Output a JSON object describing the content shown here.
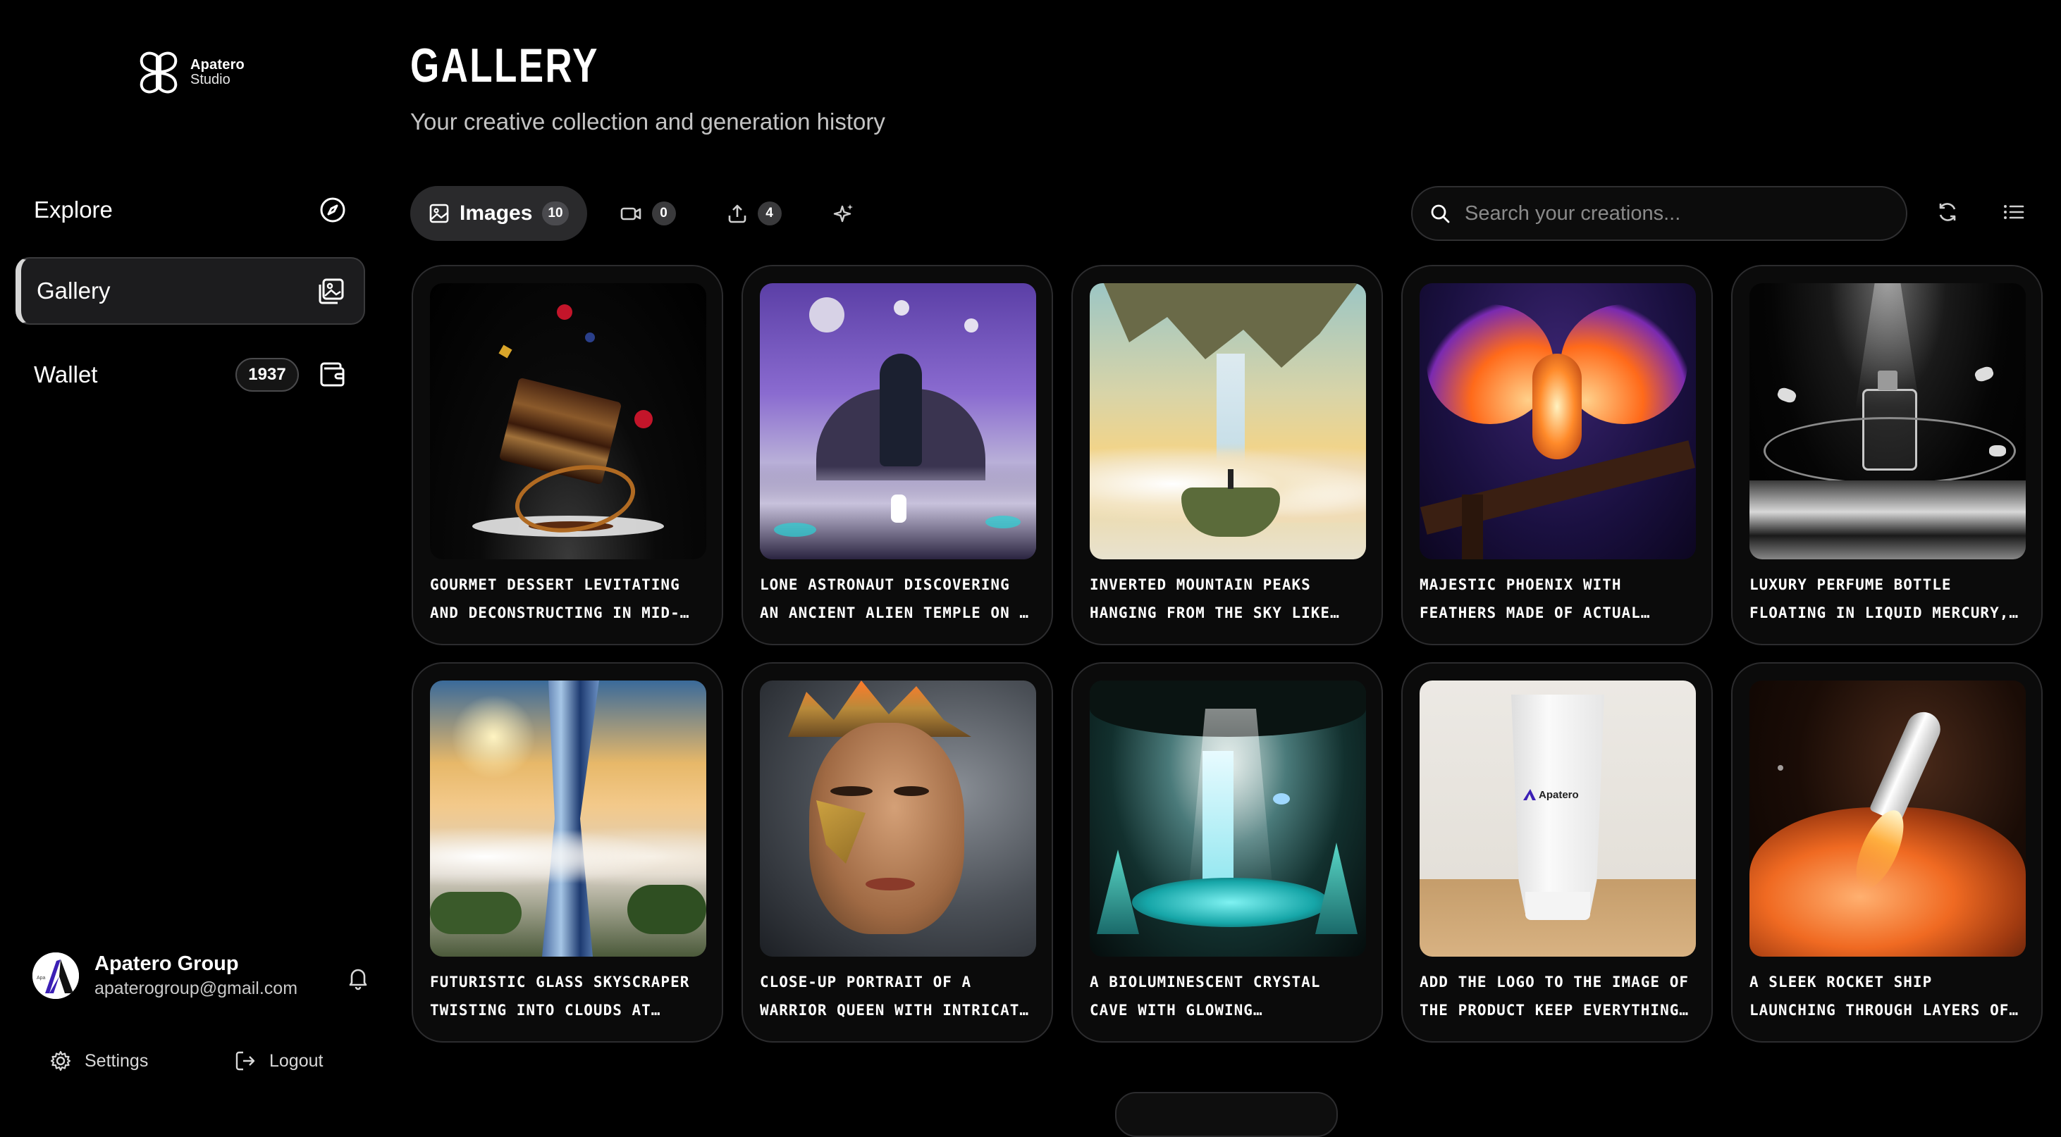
{
  "brand": {
    "name": "Apatero",
    "sub": "Studio"
  },
  "sidebar": {
    "items": [
      {
        "label": "Explore",
        "icon": "compass-icon"
      },
      {
        "label": "Gallery",
        "icon": "gallery-icon",
        "active": true
      },
      {
        "label": "Wallet",
        "icon": "wallet-icon",
        "badge": "1937"
      }
    ]
  },
  "user": {
    "name": "Apatero Group",
    "email": "apaterogroup@gmail.com"
  },
  "footer": {
    "settings": "Settings",
    "logout": "Logout"
  },
  "header": {
    "title": "GALLERY",
    "subtitle": "Your creative collection and generation history"
  },
  "tabs": [
    {
      "label": "Images",
      "count": "10",
      "icon": "image-icon",
      "active": true
    },
    {
      "label": "",
      "count": "0",
      "icon": "video-icon"
    },
    {
      "label": "",
      "count": "4",
      "icon": "upload-icon"
    },
    {
      "label": "",
      "count": "",
      "icon": "sparkle-icon"
    }
  ],
  "search": {
    "placeholder": "Search your creations...",
    "value": ""
  },
  "cards": [
    {
      "caption": "GOURMET DESSERT LEVITATING AND DECONSTRUCTING IN MID-AIR, LAYER..."
    },
    {
      "caption": "LONE ASTRONAUT DISCOVERING AN ANCIENT ALIEN TEMPLE ON A DISTAN..."
    },
    {
      "caption": "INVERTED MOUNTAIN PEAKS HANGING FROM THE SKY LIKE CHANDELIERS,..."
    },
    {
      "caption": "MAJESTIC PHOENIX WITH FEATHERS MADE OF ACTUAL FLAMES AND..."
    },
    {
      "caption": "LUXURY PERFUME BOTTLE FLOATING IN LIQUID MERCURY, SURROUNDED BY..."
    },
    {
      "caption": "FUTURISTIC GLASS SKYSCRAPER TWISTING INTO CLOUDS AT GOLDEN..."
    },
    {
      "caption": "CLOSE-UP PORTRAIT OF A WARRIOR QUEEN WITH INTRICATE GOLD WAR..."
    },
    {
      "caption": "A BIOLUMINESCENT CRYSTAL CAVE WITH GLOWING TURQUOISE..."
    },
    {
      "caption": "ADD THE LOGO TO THE IMAGE OF THE PRODUCT KEEP EVERYTHING THE SAME"
    },
    {
      "caption": "A SLEEK ROCKET SHIP LAUNCHING THROUGH LAYERS OF VIBRANT ORANG..."
    }
  ],
  "product_logo": "Apatero",
  "colors": {
    "background": "#000000",
    "card_border": "#2c2c2e",
    "active_tab": "#2a2a2c",
    "accent_avatar": "#3b1fb5"
  }
}
